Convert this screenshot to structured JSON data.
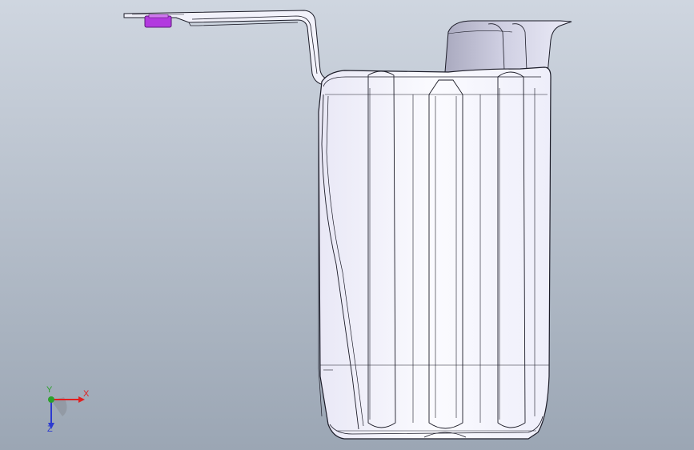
{
  "viewport": {
    "background_top": "#cfd6e0",
    "background_bottom": "#9ba6b4"
  },
  "model": {
    "name": "tank-with-mounting-bracket",
    "body_fill": "#f7f6ff",
    "edge_color": "#1c1c28",
    "shade_color": "#c9c9e0",
    "fastener_color": "#b23adf"
  },
  "triad": {
    "x_label": "X",
    "y_label": "Y",
    "z_label": "Z",
    "x_color": "#e02020",
    "y_color": "#2ca02c",
    "z_color": "#2c3ad0"
  }
}
